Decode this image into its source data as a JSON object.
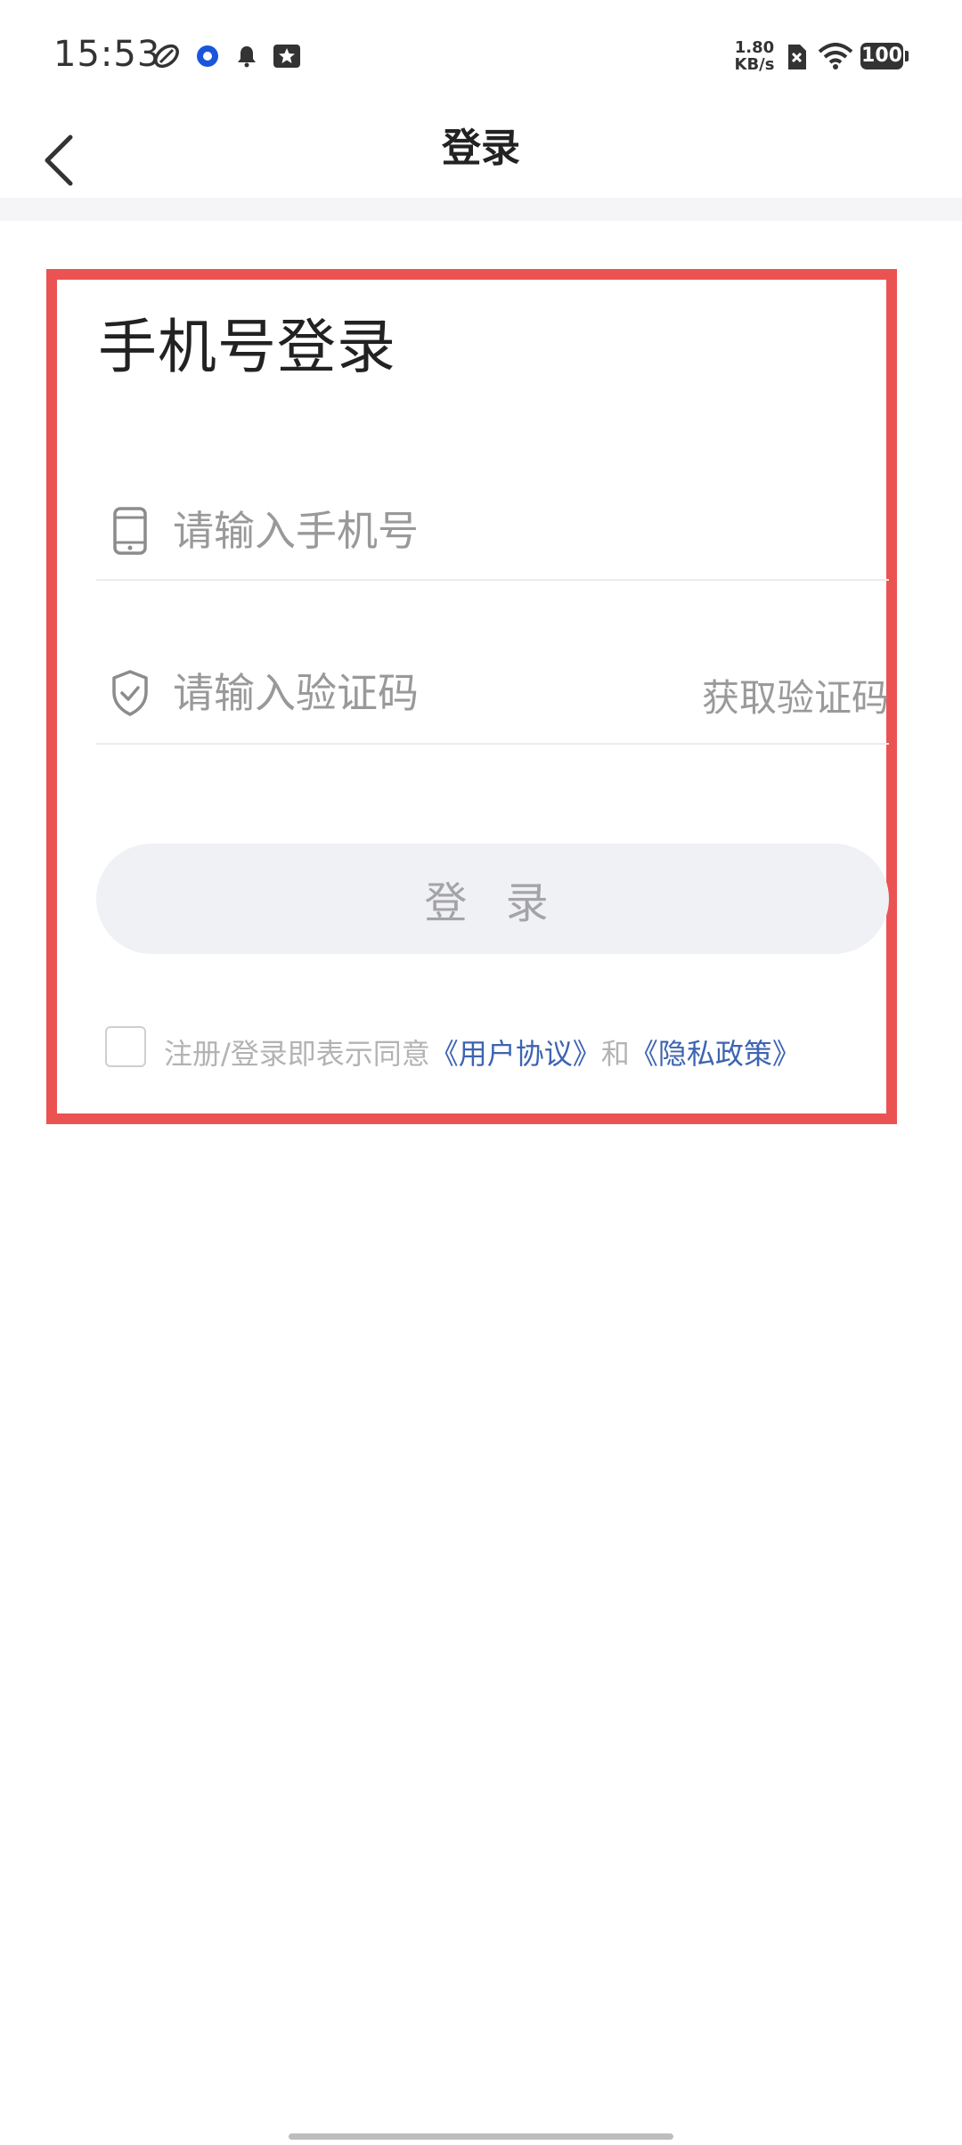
{
  "status_bar": {
    "time": "15:53",
    "net_speed_value": "1.80",
    "net_speed_unit": "KB/s",
    "battery": "100",
    "icons": [
      "rugby-ball-icon",
      "blue-circle-app-icon",
      "bell-icon",
      "star-card-icon",
      "sim-off-icon",
      "wifi-icon"
    ]
  },
  "nav": {
    "title": "登录",
    "back_icon": "chevron-left-icon"
  },
  "form": {
    "heading": "手机号登录",
    "phone_placeholder": "请输入手机号",
    "phone_value": "",
    "phone_icon": "mobile-phone-icon",
    "code_placeholder": "请输入验证码",
    "code_value": "",
    "code_icon": "shield-check-icon",
    "get_code_label": "获取验证码",
    "login_label": "登 录",
    "agreement_prefix": "注册/登录即表示同意",
    "user_agreement": "《用户协议》",
    "conjunction": "和",
    "privacy_policy": "《隐私政策》",
    "agreement_checked": false
  },
  "colors": {
    "highlight_border": "#ea5352",
    "link": "#3d64b2",
    "button_bg": "#f0f1f5",
    "button_text": "#a4a4a8"
  }
}
